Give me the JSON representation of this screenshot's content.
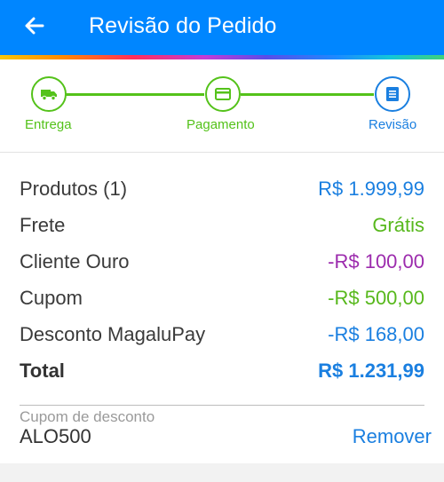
{
  "header": {
    "title": "Revisão do Pedido",
    "back_icon": "arrow-left-icon",
    "background_color": "#0086ff"
  },
  "stepper": {
    "steps": [
      {
        "label": "Entrega",
        "icon": "truck-icon",
        "state": "completed"
      },
      {
        "label": "Pagamento",
        "icon": "card-icon",
        "state": "completed"
      },
      {
        "label": "Revisão",
        "icon": "list-icon",
        "state": "current"
      }
    ],
    "completed_color": "#54c21a",
    "current_color": "#1a7fe0"
  },
  "summary": {
    "rows": [
      {
        "label": "Produtos (1)",
        "value": "R$ 1.999,99"
      },
      {
        "label": "Frete",
        "value": "Grátis"
      },
      {
        "label": "Cliente Ouro",
        "value": "-R$ 100,00"
      },
      {
        "label": "Cupom",
        "value": "-R$ 500,00"
      },
      {
        "label": "Desconto MagaluPay",
        "value": "-R$ 168,00"
      }
    ],
    "total": {
      "label": "Total",
      "value": "R$ 1.231,99"
    }
  },
  "coupon": {
    "label": "Cupom de desconto",
    "code": "ALO500",
    "remove_label": "Remover"
  }
}
